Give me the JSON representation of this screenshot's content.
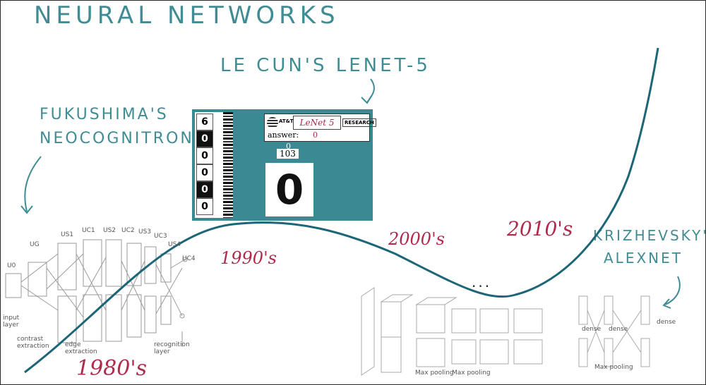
{
  "title": "NEURAL NETWORKS",
  "annotations": {
    "lecun": "LE CUN'S LENET-5",
    "fukushima_line1": "FUKUSHIMA'S",
    "fukushima_line2": "NEOCOGNITRON",
    "krizhevsky_line1": "KRIZHEVSKY'S",
    "krizhevsky_line2": "ALEXNET",
    "ellipsis": "..."
  },
  "decades": [
    "1980's",
    "1990's",
    "2000's",
    "2010's"
  ],
  "lenet_demo": {
    "brand": "AT&T",
    "name": "LeNet 5",
    "research": "RESEARCH",
    "answer_label": "answer:",
    "answer_value": "0",
    "digit_top": "0",
    "digit_label": "103",
    "digit": "0"
  },
  "neocognitron": {
    "layers": [
      "U0",
      "UG",
      "US1",
      "UC1",
      "US2",
      "UC2",
      "US3",
      "UC3",
      "US4",
      "UC4"
    ],
    "labels": {
      "input": "input layer",
      "contrast": "contrast extraction",
      "edge": "edge extraction",
      "recognition": "recognition layer"
    }
  },
  "alexnet": {
    "labels": [
      "dense",
      "dense",
      "dense",
      "Max pooling",
      "Max pooling",
      "Max pooling"
    ]
  },
  "colors": {
    "handwriting": "#3f8c95",
    "decade": "#b02a4c",
    "curve": "#1d6677",
    "lenet_bg": "#3a8a93"
  }
}
